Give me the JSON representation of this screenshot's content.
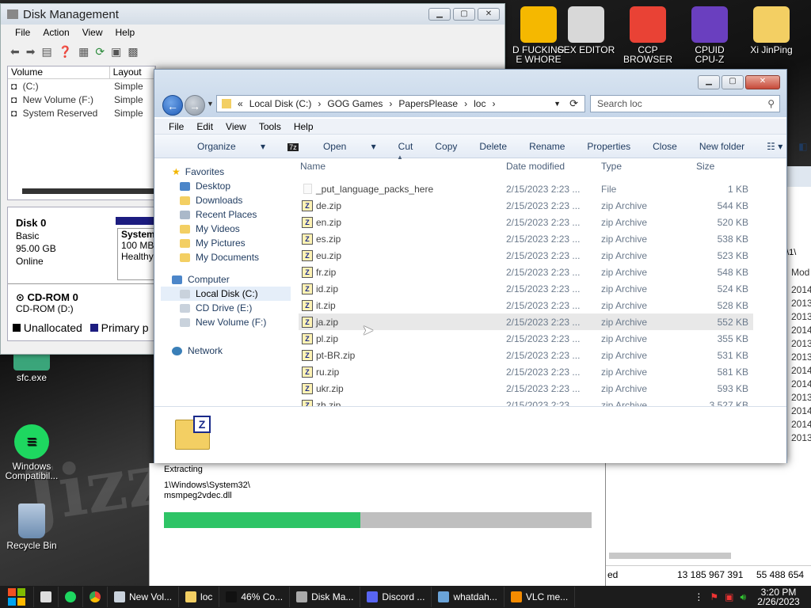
{
  "desktop": {
    "top_icons": [
      {
        "label": "D FUCKING\nE WHORE",
        "icon": "de-app-icon",
        "color": "#f5b800"
      },
      {
        "label": "SEX EDITOR",
        "icon": "hxd-icon",
        "color": "#d8d8d8"
      },
      {
        "label": "CCP\nBROWSER",
        "icon": "chrome-icon",
        "color": "#e94235"
      },
      {
        "label": "CPUID\nCPU-Z",
        "icon": "cpuz-icon",
        "color": "#6a3fbf"
      },
      {
        "label": "Xi JinPing",
        "icon": "folder-user-icon",
        "color": "#f3cf63"
      }
    ],
    "left_icons": [
      {
        "label": "sfc.exe",
        "icon": "exe-icon"
      },
      {
        "label": "Windows\nCompatibil...",
        "icon": "spotify-like-icon"
      },
      {
        "label": "Recycle Bin",
        "icon": "recycle-bin-icon"
      }
    ]
  },
  "disk_mgmt": {
    "title": "Disk Management",
    "menu": [
      "File",
      "Action",
      "View",
      "Help"
    ],
    "columns": [
      "Volume",
      "Layout"
    ],
    "volumes": [
      {
        "name": "(C:)",
        "layout": "Simple"
      },
      {
        "name": "New Volume (F:)",
        "layout": "Simple"
      },
      {
        "name": "System Reserved",
        "layout": "Simple"
      }
    ],
    "disk0": {
      "name": "Disk 0",
      "type": "Basic",
      "size": "95.00 GB",
      "status": "Online"
    },
    "partition": {
      "name": "System",
      "size": "100 MB",
      "status": "Healthy"
    },
    "cdrom": {
      "name": "CD-ROM 0",
      "drive": "CD-ROM (D:)"
    },
    "legend": [
      "Unallocated",
      "Primary p"
    ]
  },
  "explorer": {
    "address": [
      "«",
      "Local Disk (C:)",
      "GOG Games",
      "PapersPlease",
      "loc"
    ],
    "search_placeholder": "Search loc",
    "menu": [
      "File",
      "Edit",
      "View",
      "Tools",
      "Help"
    ],
    "commands": [
      "Organize",
      "Open",
      "Cut",
      "Copy",
      "Delete",
      "Rename",
      "Properties",
      "Close",
      "New folder"
    ],
    "nav": {
      "favorites": "Favorites",
      "fav_items": [
        "Desktop",
        "Downloads",
        "Recent Places",
        "My Videos",
        "My Pictures",
        "My Documents"
      ],
      "computer": "Computer",
      "comp_items": [
        "Local Disk (C:)",
        "CD Drive (E:)",
        "New Volume (F:)"
      ],
      "network": "Network"
    },
    "columns": {
      "name": "Name",
      "date": "Date modified",
      "type": "Type",
      "size": "Size"
    },
    "files": [
      {
        "name": "_put_language_packs_here",
        "date": "2/15/2023 2:23 ...",
        "type": "File",
        "size": "1 KB"
      },
      {
        "name": "de.zip",
        "date": "2/15/2023 2:23 ...",
        "type": "zip Archive",
        "size": "544 KB"
      },
      {
        "name": "en.zip",
        "date": "2/15/2023 2:23 ...",
        "type": "zip Archive",
        "size": "520 KB"
      },
      {
        "name": "es.zip",
        "date": "2/15/2023 2:23 ...",
        "type": "zip Archive",
        "size": "538 KB"
      },
      {
        "name": "eu.zip",
        "date": "2/15/2023 2:23 ...",
        "type": "zip Archive",
        "size": "523 KB"
      },
      {
        "name": "fr.zip",
        "date": "2/15/2023 2:23 ...",
        "type": "zip Archive",
        "size": "548 KB"
      },
      {
        "name": "id.zip",
        "date": "2/15/2023 2:23 ...",
        "type": "zip Archive",
        "size": "524 KB"
      },
      {
        "name": "it.zip",
        "date": "2/15/2023 2:23 ...",
        "type": "zip Archive",
        "size": "528 KB"
      },
      {
        "name": "ja.zip",
        "date": "2/15/2023 2:23 ...",
        "type": "zip Archive",
        "size": "552 KB"
      },
      {
        "name": "pl.zip",
        "date": "2/15/2023 2:23 ...",
        "type": "zip Archive",
        "size": "355 KB"
      },
      {
        "name": "pt-BR.zip",
        "date": "2/15/2023 2:23 ...",
        "type": "zip Archive",
        "size": "531 KB"
      },
      {
        "name": "ru.zip",
        "date": "2/15/2023 2:23 ...",
        "type": "zip Archive",
        "size": "581 KB"
      },
      {
        "name": "ukr.zip",
        "date": "2/15/2023 2:23 ...",
        "type": "zip Archive",
        "size": "593 KB"
      },
      {
        "name": "zh.zip",
        "date": "2/15/2023 2:23 ...",
        "type": "zip Archive",
        "size": "3.527 KB"
      }
    ]
  },
  "extract": {
    "label": "Extracting",
    "path1": "1\\Windows\\System32\\",
    "path2": "msmpeg2vdec.dll",
    "progress": 0.46
  },
  "right_win": {
    "path": "n\\1\\",
    "col": "Mod",
    "years": [
      "2014",
      "2013",
      "2013",
      "2014",
      "2013",
      "2013",
      "2014",
      "2014",
      "2013",
      "2014",
      "2014",
      "2013"
    ],
    "status": "ed",
    "num1": "13 185 967 391",
    "num2": "55 488 654"
  },
  "taskbar": {
    "items": [
      {
        "label": "New Vol...",
        "icon": "drive-icon"
      },
      {
        "label": "loc",
        "icon": "folder-icon"
      },
      {
        "label": "46% Co...",
        "icon": "7zip-icon"
      },
      {
        "label": "Disk Ma...",
        "icon": "disk-mgmt-icon"
      },
      {
        "label": "Discord ...",
        "icon": "discord-icon"
      },
      {
        "label": "whatdah...",
        "icon": "image-icon"
      },
      {
        "label": "VLC me...",
        "icon": "vlc-icon"
      }
    ],
    "time": "3:20 PM",
    "date": "2/26/2023"
  }
}
